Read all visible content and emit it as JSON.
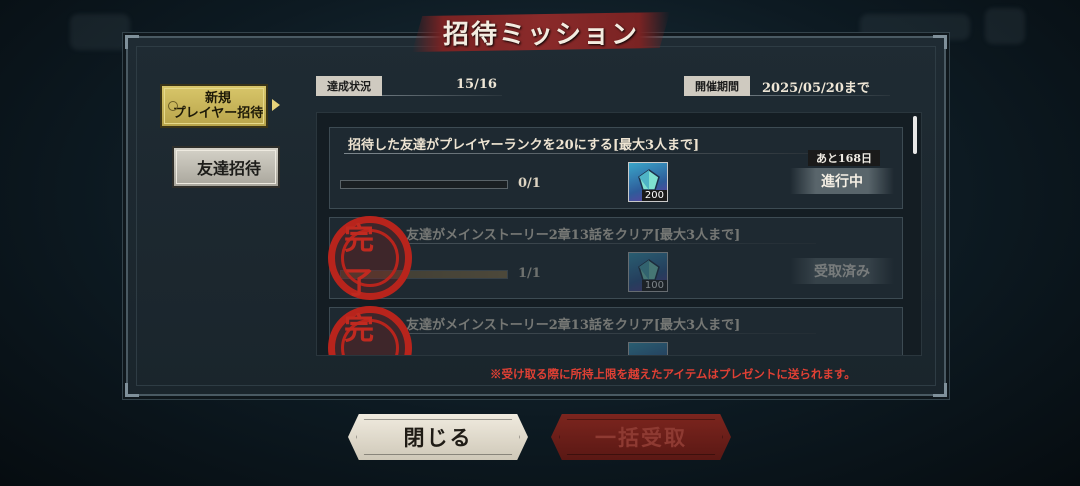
{
  "title": "招待ミッション",
  "tabs": [
    {
      "label": "新規\nプレイヤー招待",
      "active": true
    },
    {
      "label": "友達招待",
      "active": false
    }
  ],
  "status_info": {
    "label": "達成状況",
    "value": "15/16"
  },
  "period_info": {
    "label": "開催期間",
    "value": "2025/05/20まで"
  },
  "missions": [
    {
      "title": "招待した友達がプレイヤーランクを20にする[最大3人まで]",
      "progress": "0/1",
      "progress_fraction": 0,
      "reward_qty": "200",
      "remaining": "あと168日",
      "status": "進行中",
      "completed": false
    },
    {
      "title": "友達がメインストーリー2章13話をクリア[最大3人まで]",
      "progress": "1/1",
      "progress_fraction": 1,
      "reward_qty": "100",
      "status": "受取済み",
      "completed": true
    },
    {
      "title": "友達がメインストーリー2章13話をクリア[最大3人まで]",
      "completed": true
    }
  ],
  "stamp_text": "完了",
  "notice": "※受け取る際に所持上限を越えたアイテムはプレゼントに送られます。",
  "buttons": {
    "close": "閉じる",
    "claim_all": "一括受取"
  },
  "colors": {
    "accent_gold": "#d8c66a",
    "title_red": "#8a2a2a",
    "notice_red": "#e04034",
    "stamp_red": "#b8241c"
  }
}
